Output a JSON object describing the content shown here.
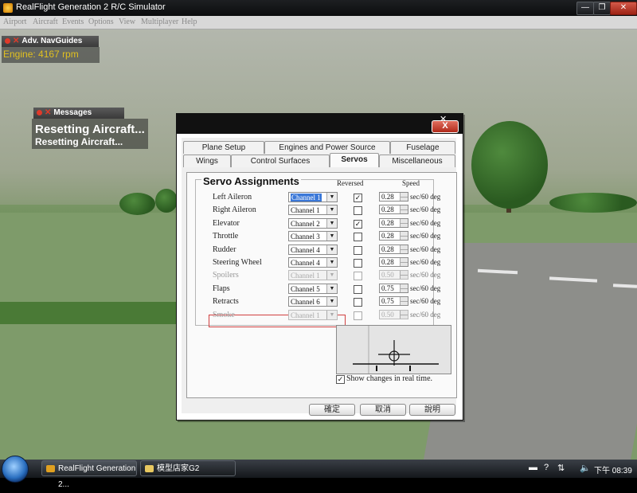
{
  "window": {
    "title": "RealFlight Generation 2 R/C Simulator",
    "buttons": {
      "minimize": "—",
      "maximize": "❐",
      "close": "✕"
    }
  },
  "menu": [
    "Airport",
    "Aircraft",
    "Events",
    "Options",
    "View",
    "Multiplayer",
    "Help"
  ],
  "hud": {
    "navguides_tab": "Adv. NavGuides",
    "engine_text": "Engine: 4167 rpm",
    "messages_tab": "Messages",
    "message_title": "Resetting Aircraft...",
    "message_sub": "Resetting Aircraft..."
  },
  "dialog": {
    "close_label": "X",
    "tabs_row1": [
      "Plane Setup",
      "Engines and Power Source",
      "Fuselage"
    ],
    "tabs_row2": [
      "Wings",
      "Control Surfaces",
      "Servos",
      "Miscellaneous"
    ],
    "active_tab": "Servos",
    "group_title": "Servo Assignments",
    "col_reversed": "Reversed",
    "col_speed": "Speed",
    "unit": "sec/60 deg",
    "rows": [
      {
        "label": "Left Aileron",
        "channel": "Channel 1",
        "reversed": true,
        "speed": "0.28",
        "enabled": true,
        "highlight": true
      },
      {
        "label": "Right Aileron",
        "channel": "Channel 1",
        "reversed": false,
        "speed": "0.28",
        "enabled": true
      },
      {
        "label": "Elevator",
        "channel": "Channel 2",
        "reversed": true,
        "speed": "0.28",
        "enabled": true
      },
      {
        "label": "Throttle",
        "channel": "Channel 3",
        "reversed": false,
        "speed": "0.28",
        "enabled": true
      },
      {
        "label": "Rudder",
        "channel": "Channel 4",
        "reversed": false,
        "speed": "0.28",
        "enabled": true
      },
      {
        "label": "Steering Wheel",
        "channel": "Channel 4",
        "reversed": false,
        "speed": "0.28",
        "enabled": true
      },
      {
        "label": "Spoilers",
        "channel": "Channel 1",
        "reversed": false,
        "speed": "0.50",
        "enabled": false
      },
      {
        "label": "Flaps",
        "channel": "Channel 5",
        "reversed": false,
        "speed": "0.75",
        "enabled": true
      },
      {
        "label": "Retracts",
        "channel": "Channel 6",
        "reversed": false,
        "speed": "0.75",
        "enabled": true,
        "outlined": true
      },
      {
        "label": "Smoke",
        "channel": "Channel 1",
        "reversed": false,
        "speed": "0.50",
        "enabled": false
      }
    ],
    "show_changes_label": "Show changes in real time.",
    "show_changes_checked": true,
    "buttons": {
      "ok": "確定",
      "cancel": "取消",
      "help": "說明"
    }
  },
  "taskbar": {
    "tasks": [
      "RealFlight Generation 2...",
      "模型店家G2"
    ],
    "clock": "下午 08:39"
  },
  "colors": {
    "selection": "#3b78d8",
    "outline": "#d04040",
    "hud_accent": "#e03a2a",
    "engine_text": "#e0c020"
  }
}
